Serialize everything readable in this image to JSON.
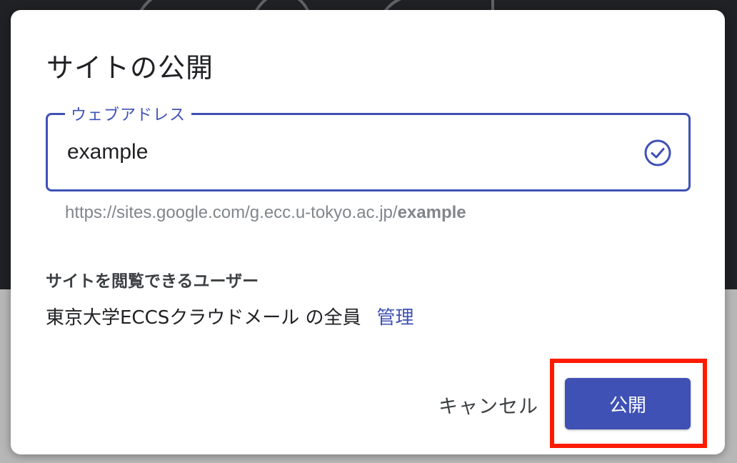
{
  "dialog": {
    "title": "サイトの公開",
    "web_address": {
      "label": "ウェブアドレス",
      "value": "example",
      "status_icon": "check-circle-icon"
    },
    "url_hint": {
      "prefix": "https://sites.google.com/g.ecc.u-tokyo.ac.jp/",
      "slug": "example"
    },
    "viewers": {
      "heading": "サイトを閲覧できるユーザー",
      "audience": "東京大学ECCSクラウドメール の全員",
      "manage_label": "管理"
    },
    "actions": {
      "cancel_label": "キャンセル",
      "publish_label": "公開"
    }
  },
  "colors": {
    "accent": "#3f51b5",
    "highlight": "#ff1a00",
    "backdrop": "#202124"
  }
}
